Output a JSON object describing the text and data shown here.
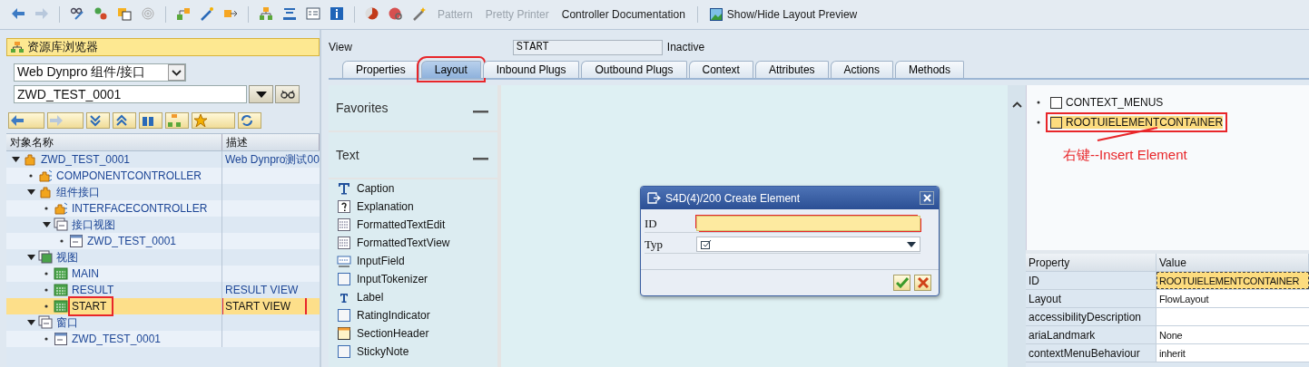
{
  "toolbar": {
    "buttons": [
      {
        "label": "Pattern",
        "disabled": true
      },
      {
        "label": "Pretty Printer",
        "disabled": true
      },
      {
        "label": "Controller Documentation",
        "disabled": false
      },
      {
        "label": "Show/Hide Layout Preview",
        "disabled": false,
        "kind": "icon"
      }
    ]
  },
  "browser": {
    "title": "资源库浏览器",
    "object_type": "Web Dynpro 组件/接口",
    "object_name": "ZWD_TEST_0001",
    "columns": [
      "对象名称",
      "描述"
    ],
    "tree": [
      {
        "label": "ZWD_TEST_0001",
        "description": "Web Dynpro测试00",
        "kind": "component",
        "expanded": true,
        "selected": false,
        "children": [
          {
            "label": "COMPONENTCONTROLLER",
            "kind": "controller",
            "selected": false
          },
          {
            "label": "组件接口",
            "kind": "component",
            "expanded": true,
            "selected": false,
            "children": [
              {
                "label": "INTERFACECONTROLLER",
                "kind": "controller",
                "selected": false
              },
              {
                "label": "接口视图",
                "kind": "folder",
                "expanded": true,
                "selected": false,
                "children": [
                  {
                    "label": "ZWD_TEST_0001",
                    "kind": "window",
                    "selected": false
                  }
                ]
              }
            ]
          },
          {
            "label": "视图",
            "kind": "view-folder",
            "expanded": true,
            "selected": false,
            "children": [
              {
                "label": "MAIN",
                "kind": "view",
                "selected": false
              },
              {
                "label": "RESULT",
                "description": "RESULT VIEW",
                "kind": "view",
                "selected": false
              },
              {
                "label": "START",
                "description": "START VIEW",
                "kind": "view",
                "selected": true,
                "highlighted": true
              }
            ]
          },
          {
            "label": "窗口",
            "kind": "folder",
            "expanded": true,
            "selected": false,
            "children": [
              {
                "label": "ZWD_TEST_0001",
                "kind": "window",
                "selected": false
              }
            ]
          }
        ]
      }
    ]
  },
  "view": {
    "label": "View",
    "name": "START",
    "status": "Inactive"
  },
  "tabs": [
    {
      "label": "Properties",
      "selected": false
    },
    {
      "label": "Layout",
      "selected": true,
      "highlighted": true
    },
    {
      "label": "Inbound Plugs",
      "selected": false
    },
    {
      "label": "Outbound Plugs",
      "selected": false
    },
    {
      "label": "Context",
      "selected": false
    },
    {
      "label": "Attributes",
      "selected": false
    },
    {
      "label": "Actions",
      "selected": false
    },
    {
      "label": "Methods",
      "selected": false
    }
  ],
  "palette": {
    "groups": [
      {
        "title": "Favorites",
        "expanded": true
      },
      {
        "title": "Text",
        "expanded": true,
        "items": [
          {
            "label": "Caption",
            "kind": "caption"
          },
          {
            "label": "Explanation",
            "kind": "explanation"
          },
          {
            "label": "FormattedTextEdit",
            "kind": "formatted"
          },
          {
            "label": "FormattedTextView",
            "kind": "formatted"
          },
          {
            "label": "InputField",
            "kind": "input"
          },
          {
            "label": "InputTokenizer",
            "kind": "blank"
          },
          {
            "label": "Label",
            "kind": "label"
          },
          {
            "label": "RatingIndicator",
            "kind": "blank"
          },
          {
            "label": "SectionHeader",
            "kind": "section"
          },
          {
            "label": "StickyNote",
            "kind": "blank"
          }
        ]
      }
    ]
  },
  "dialog": {
    "title": "S4D(4)/200 Create Element",
    "fields": [
      {
        "label": "ID",
        "kind": "text",
        "required": true
      },
      {
        "label": "Typ",
        "kind": "select"
      }
    ]
  },
  "hierarchy": {
    "nodes": [
      {
        "label": "CONTEXT_MENUS",
        "selected": false,
        "highlighted": false
      },
      {
        "label": "ROOTUIELEMENTCONTAINER",
        "selected": true,
        "highlighted": true
      }
    ],
    "annotation": "右键--Insert Element"
  },
  "properties": {
    "columns": [
      "Property",
      "Value"
    ],
    "rows": [
      {
        "property": "ID",
        "value": "ROOTUIELEMENTCONTAINER",
        "selected": true
      },
      {
        "property": "Layout",
        "value": "FlowLayout",
        "selected": false
      },
      {
        "property": "accessibilityDescription",
        "selected": false
      },
      {
        "property": "ariaLandmark",
        "value": "None",
        "selected": false
      },
      {
        "property": "contextMenuBehaviour",
        "value": "inherit",
        "selected": false
      }
    ]
  }
}
